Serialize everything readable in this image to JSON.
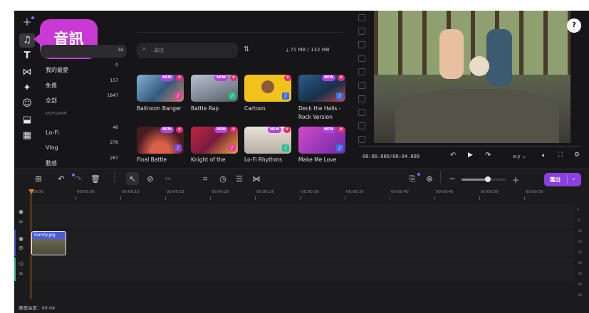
{
  "rail": {
    "icons": [
      "plus-icon",
      "music-icon",
      "text-icon",
      "transition-icon",
      "effects-icon",
      "sticker-icon",
      "element-icon",
      "grid-icon"
    ]
  },
  "callout": {
    "label": "音訊"
  },
  "library": {
    "categories": [
      {
        "label": "",
        "count": "34"
      },
      {
        "label": "我的最愛",
        "count": "0"
      },
      {
        "label": "免費",
        "count": "157"
      },
      {
        "label": "全部",
        "count": "1847"
      }
    ],
    "section_label": "KATEGORIM",
    "genres": [
      {
        "label": "Lo-Fi",
        "count": "46"
      },
      {
        "label": "Vlog",
        "count": "276"
      },
      {
        "label": "動感",
        "count": "267"
      }
    ],
    "search_placeholder": "尋找",
    "storage": "71 MB / 132 MB",
    "cards": [
      {
        "title": "Ballroom Banger",
        "new": "NEW"
      },
      {
        "title": "Battle Rap",
        "new": "NEW"
      },
      {
        "title": "Cartoon",
        "new": ""
      },
      {
        "title": "Deck the Halls - Rock Version",
        "new": "NEW"
      },
      {
        "title": "Final Battle",
        "new": "NEW"
      },
      {
        "title": "Knight of the",
        "new": "NEW"
      },
      {
        "title": "Lo-Fi Rhythms",
        "new": "NEW"
      },
      {
        "title": "Make Me Love",
        "new": "NEW"
      }
    ]
  },
  "preview": {
    "timecode": "00:00.000/00:04.000",
    "aspect": "x:y",
    "help": "?"
  },
  "timeline": {
    "export_label": "匯出",
    "ticks": [
      "00:00",
      "00:00:05",
      "00:00:10",
      "00:00:15",
      "00:00:20",
      "00:00:25",
      "00:00:30",
      "00:00:35",
      "00:00:40",
      "00:00:45",
      "00:00:50",
      "00:00:55"
    ],
    "clip_name": "Family.jpg",
    "project_length": "專案長度：00:04",
    "zoom_fraction": 0.6,
    "meter_labels": [
      "0",
      "-5",
      "-12",
      "-20",
      "-25",
      "-32",
      "-38",
      "-40",
      "-42"
    ]
  },
  "colors": {
    "accent": "#7b6cff",
    "new_badge": "#b341e8",
    "crown": "#e82d74",
    "playhead": "#e07a20",
    "export": "#8b3fe0"
  }
}
